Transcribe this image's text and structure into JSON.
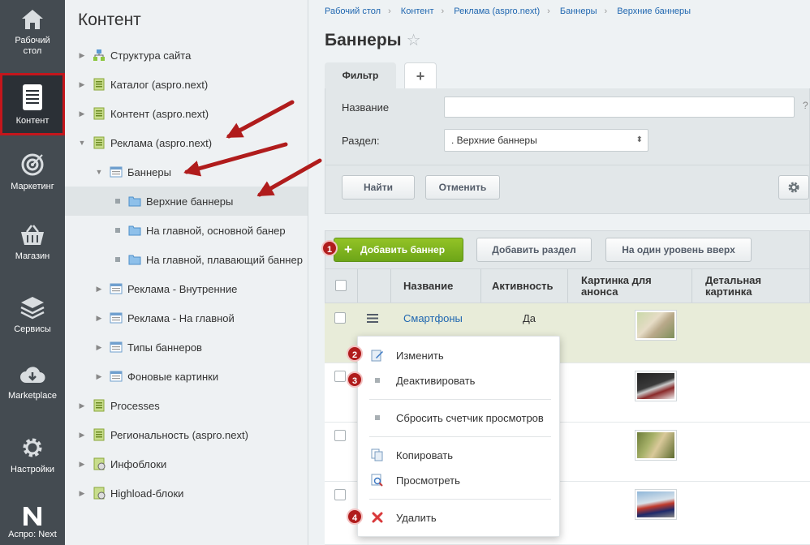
{
  "rail": [
    {
      "label": "Рабочий стол",
      "icon": "home-icon"
    },
    {
      "label": "Контент",
      "icon": "document-icon",
      "active": true
    },
    {
      "label": "Маркетинг",
      "icon": "target-icon"
    },
    {
      "label": "Магазин",
      "icon": "basket-icon"
    },
    {
      "label": "Сервисы",
      "icon": "layers-icon"
    },
    {
      "label": "Marketplace",
      "icon": "cloud-download-icon"
    },
    {
      "label": "Настройки",
      "icon": "gear-icon"
    },
    {
      "label": "Аспро: Next",
      "icon": "aspro-logo-icon"
    }
  ],
  "tree": {
    "title": "Контент",
    "items": [
      {
        "label": "Структура сайта"
      },
      {
        "label": "Каталог (aspro.next)"
      },
      {
        "label": "Контент (aspro.next)"
      },
      {
        "label": "Реклама (aspro.next)"
      },
      {
        "label": "Баннеры"
      },
      {
        "label": "Верхние баннеры"
      },
      {
        "label": "На главной, основной банер"
      },
      {
        "label": "На главной, плавающий баннер"
      },
      {
        "label": "Реклама - Внутренние"
      },
      {
        "label": "Реклама - На главной"
      },
      {
        "label": "Типы баннеров"
      },
      {
        "label": "Фоновые картинки"
      },
      {
        "label": "Processes"
      },
      {
        "label": "Региональность (aspro.next)"
      },
      {
        "label": "Инфоблоки"
      },
      {
        "label": "Highload-блоки"
      }
    ]
  },
  "breadcrumbs": [
    "Рабочий стол",
    "Контент",
    "Реклама (aspro.next)",
    "Баннеры",
    "Верхние баннеры"
  ],
  "page": {
    "title": "Баннеры",
    "star": "☆"
  },
  "filter": {
    "tab_label": "Фильтр",
    "add_tab": "+",
    "name_label": "Название",
    "name_value": "",
    "help": "?",
    "section_label": "Раздел:",
    "section_value": ". Верхние баннеры",
    "find": "Найти",
    "cancel": "Отменить"
  },
  "toolbar": {
    "add_banner": "Добавить баннер",
    "add_section": "Добавить раздел",
    "level_up": "На один уровень вверх"
  },
  "grid": {
    "columns": [
      "Название",
      "Активность",
      "Картинка для анонса",
      "Детальная картинка"
    ],
    "rows": [
      {
        "name": "Смартфоны",
        "active": "Да"
      }
    ]
  },
  "menu": {
    "items": [
      "Изменить",
      "Деактивировать",
      "Сбросить счетчик просмотров",
      "Копировать",
      "Просмотреть",
      "Удалить"
    ]
  },
  "badges": [
    "1",
    "2",
    "3",
    "4"
  ],
  "colors": {
    "accent_green": "#7cb51f",
    "annotation_red": "#b01c1c",
    "link_blue": "#2067b0",
    "rail_bg": "#444b51"
  }
}
